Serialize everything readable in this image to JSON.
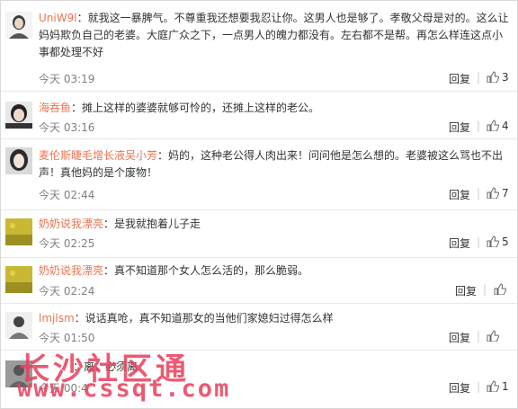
{
  "comments": [
    {
      "user": "UniW9l",
      "text": "：就我这一暴脾气。不尊重我还想要我忍让你。这男人也是够了。孝敬父母是对的。这么让妈妈欺负自己的老婆。大庭广众之下，一点男人的魄力都没有。左右都不是帮。再怎么样连这点小事都处理不好",
      "time": "今天 03:19",
      "reply": "回复",
      "likes": "3"
    },
    {
      "user": "海吞鱼",
      "text": "：摊上这样的婆婆就够可怜的，还摊上这样的老公。",
      "time": "今天 03:16",
      "reply": "回复",
      "likes": "4"
    },
    {
      "user": "麦伦斯睫毛增长液吴小芳",
      "text": "：妈的，这种老公得人肉出来！问问他是怎么想的。老婆被这么骂也不出声！真他妈的是个废物！",
      "time": "今天 02:44",
      "reply": "回复",
      "likes": "7"
    },
    {
      "user": "奶奶说我漂亮",
      "text": "：是我就抱着儿子走",
      "time": "今天 02:25",
      "reply": "回复",
      "likes": "5"
    },
    {
      "user": "奶奶说我漂亮",
      "text": "：真不知道那个女人怎么活的，那么脆弱。",
      "time": "今天 02:24",
      "reply": "回复",
      "likes": ""
    },
    {
      "user": "lmjlsm",
      "text": "：说话真呛，真不知道那女的当他们家媳妇过得怎么样",
      "time": "今天 01:50",
      "reply": "回复",
      "likes": ""
    },
    {
      "user": "",
      "text": "：离，必须离",
      "time": "今天 00:4",
      "reply": "回复",
      "likes": "1"
    }
  ],
  "watermark": {
    "line1": "长沙社区通",
    "line2": "www.cssqt.com"
  }
}
